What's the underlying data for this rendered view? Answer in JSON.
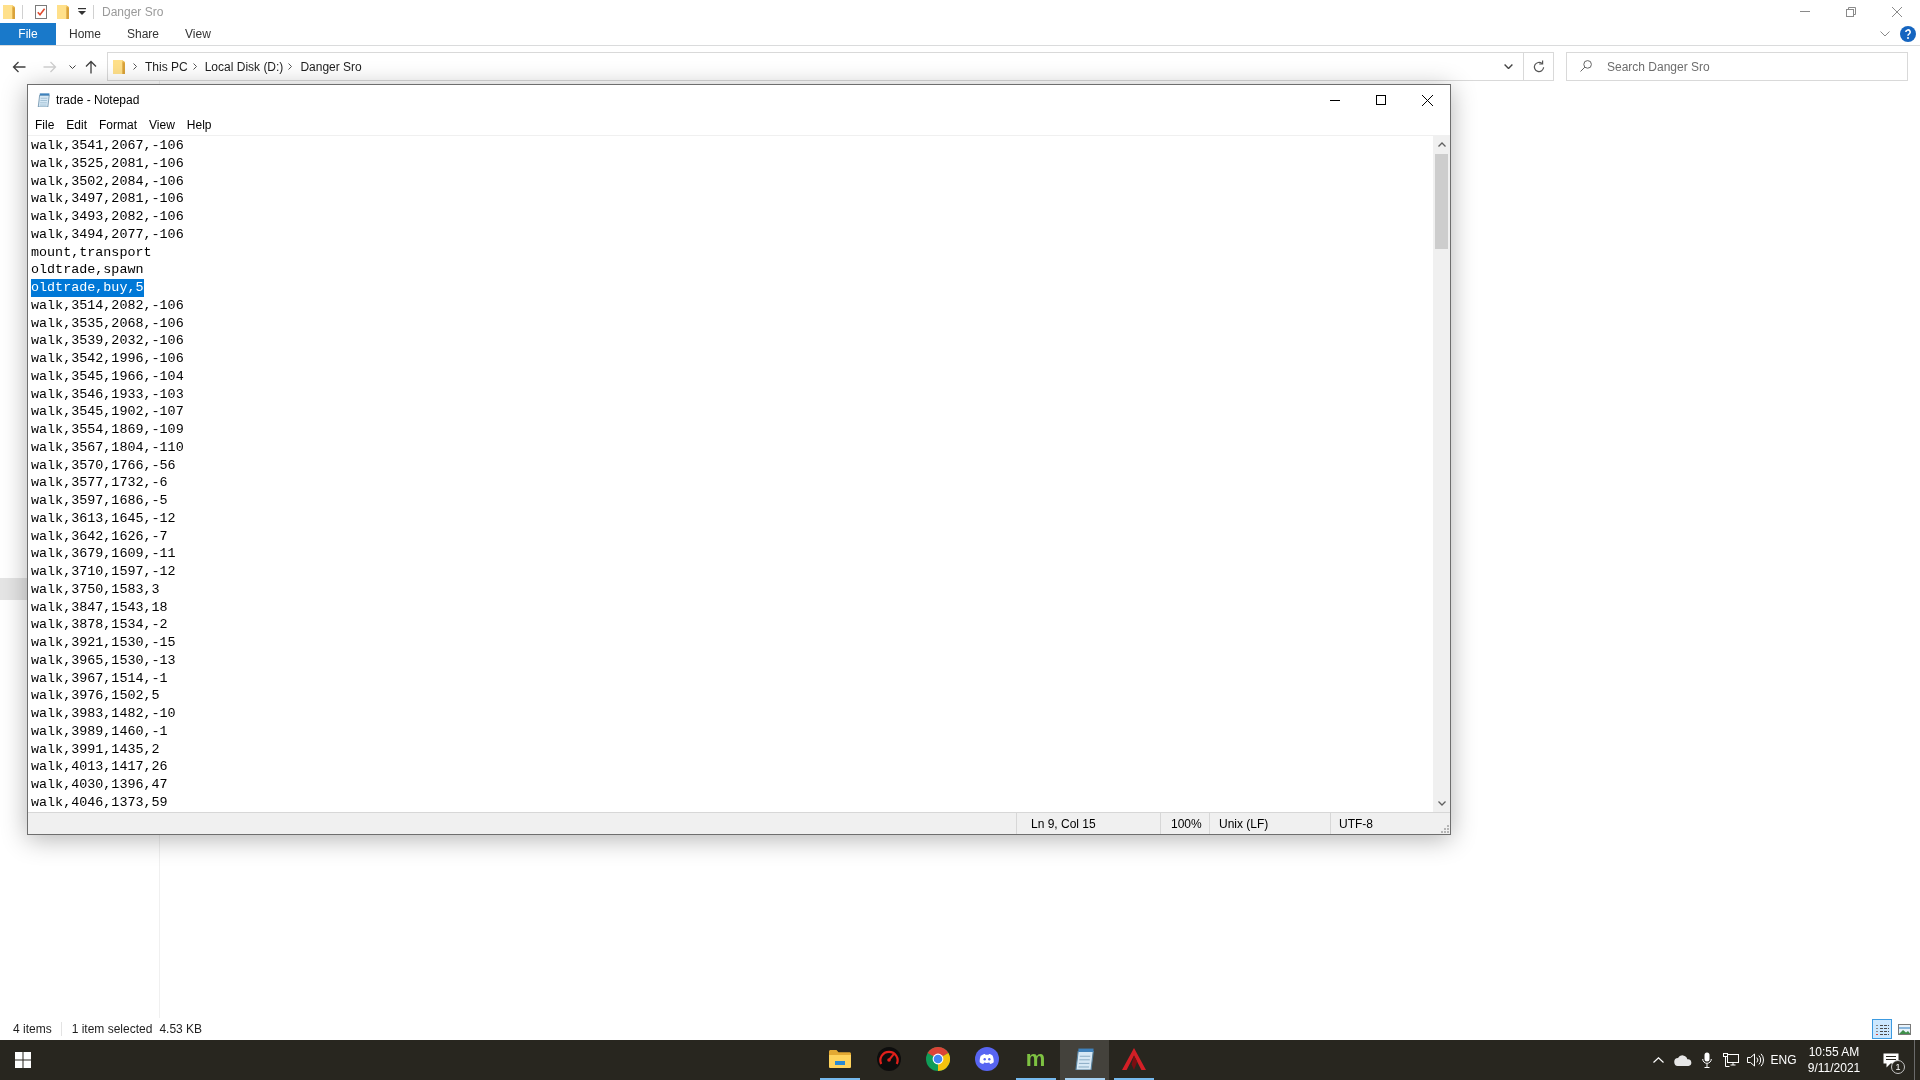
{
  "explorer": {
    "title": "Danger Sro",
    "ribbon_tabs": [
      {
        "label": "File",
        "kind": "menu"
      },
      {
        "label": "Home",
        "kind": "tab"
      },
      {
        "label": "Share",
        "kind": "tab"
      },
      {
        "label": "View",
        "kind": "tab"
      }
    ],
    "navigation": [
      {
        "kind": "back",
        "disabled": false
      },
      {
        "kind": "forward",
        "disabled": true
      },
      {
        "kind": "recent",
        "disabled": false
      },
      {
        "kind": "up",
        "disabled": false
      }
    ],
    "breadcrumb": [
      "This PC",
      "Local Disk (D:)",
      "Danger Sro"
    ],
    "search": {
      "placeholder": "Search Danger Sro"
    },
    "status_bar": {
      "item_count": "4 items",
      "selection": "1 item selected",
      "size": "4.53 KB"
    },
    "view_modes": [
      {
        "kind": "details",
        "selected": true
      },
      {
        "kind": "large_icons",
        "selected": false
      }
    ]
  },
  "notepad": {
    "title": "trade - Notepad",
    "menu": [
      "File",
      "Edit",
      "Format",
      "View",
      "Help"
    ],
    "lines": [
      {
        "text": "walk,3541,2067,-106",
        "selected": false
      },
      {
        "text": "walk,3525,2081,-106",
        "selected": false
      },
      {
        "text": "walk,3502,2084,-106",
        "selected": false
      },
      {
        "text": "walk,3497,2081,-106",
        "selected": false
      },
      {
        "text": "walk,3493,2082,-106",
        "selected": false
      },
      {
        "text": "walk,3494,2077,-106",
        "selected": false
      },
      {
        "text": "mount,transport",
        "selected": false
      },
      {
        "text": "oldtrade,spawn",
        "selected": false
      },
      {
        "text": "oldtrade,buy,5",
        "selected": true
      },
      {
        "text": "walk,3514,2082,-106",
        "selected": false
      },
      {
        "text": "walk,3535,2068,-106",
        "selected": false
      },
      {
        "text": "walk,3539,2032,-106",
        "selected": false
      },
      {
        "text": "walk,3542,1996,-106",
        "selected": false
      },
      {
        "text": "walk,3545,1966,-104",
        "selected": false
      },
      {
        "text": "walk,3546,1933,-103",
        "selected": false
      },
      {
        "text": "walk,3545,1902,-107",
        "selected": false
      },
      {
        "text": "walk,3554,1869,-109",
        "selected": false
      },
      {
        "text": "walk,3567,1804,-110",
        "selected": false
      },
      {
        "text": "walk,3570,1766,-56",
        "selected": false
      },
      {
        "text": "walk,3577,1732,-6",
        "selected": false
      },
      {
        "text": "walk,3597,1686,-5",
        "selected": false
      },
      {
        "text": "walk,3613,1645,-12",
        "selected": false
      },
      {
        "text": "walk,3642,1626,-7",
        "selected": false
      },
      {
        "text": "walk,3679,1609,-11",
        "selected": false
      },
      {
        "text": "walk,3710,1597,-12",
        "selected": false
      },
      {
        "text": "walk,3750,1583,3",
        "selected": false
      },
      {
        "text": "walk,3847,1543,18",
        "selected": false
      },
      {
        "text": "walk,3878,1534,-2",
        "selected": false
      },
      {
        "text": "walk,3921,1530,-15",
        "selected": false
      },
      {
        "text": "walk,3965,1530,-13",
        "selected": false
      },
      {
        "text": "walk,3967,1514,-1",
        "selected": false
      },
      {
        "text": "walk,3976,1502,5",
        "selected": false
      },
      {
        "text": "walk,3983,1482,-10",
        "selected": false
      },
      {
        "text": "walk,3989,1460,-1",
        "selected": false
      },
      {
        "text": "walk,3991,1435,2",
        "selected": false
      },
      {
        "text": "walk,4013,1417,26",
        "selected": false
      },
      {
        "text": "walk,4030,1396,47",
        "selected": false
      },
      {
        "text": "walk,4046,1373,59",
        "selected": false
      }
    ],
    "status_bar": {
      "position": "Ln 9, Col 15",
      "zoom": "100%",
      "line_ending": "Unix (LF)",
      "encoding": "UTF-8"
    }
  },
  "taskbar": {
    "apps": [
      {
        "kind": "folder",
        "running": true,
        "active": false
      },
      {
        "kind": "gauge",
        "running": false,
        "active": false
      },
      {
        "kind": "browser",
        "running": false,
        "active": false
      },
      {
        "kind": "controller",
        "running": false,
        "active": false
      },
      {
        "kind": "letter",
        "glyph": "m",
        "running": true,
        "active": false
      },
      {
        "kind": "notepad",
        "running": true,
        "active": true
      },
      {
        "kind": "triangle",
        "running": true,
        "active": false
      }
    ],
    "tray": {
      "language": "ENG",
      "time": "10:55 AM",
      "date": "9/11/2021",
      "notification_count": "1"
    }
  }
}
